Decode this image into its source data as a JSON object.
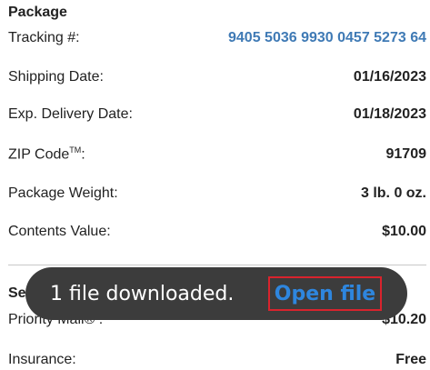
{
  "package": {
    "title": "Package",
    "rows": [
      {
        "label": "Tracking #:",
        "value": "9405 5036 9930 0457 5273 64"
      },
      {
        "label": "Shipping Date:",
        "value": "01/16/2023"
      },
      {
        "label": "Exp. Delivery Date:",
        "value": "01/18/2023"
      },
      {
        "label": "ZIP Code",
        "label_tm": "TM",
        "label_suffix": ":",
        "value": "91709"
      },
      {
        "label": "Package Weight:",
        "value": "3 lb. 0 oz."
      },
      {
        "label": "Contents Value:",
        "value": "$10.00"
      }
    ]
  },
  "service": {
    "title": "Service",
    "rows": [
      {
        "label": "Priority Mail® :",
        "value": "$10.20"
      },
      {
        "label": "Insurance:",
        "value": "Free"
      }
    ]
  },
  "toast": {
    "message": "1 file downloaded.",
    "action": "Open file"
  },
  "colors": {
    "link": "#3f7ab5",
    "toast_bg": "#3c3c3c",
    "action_text": "#2e86de",
    "highlight_border": "#d9232d"
  }
}
